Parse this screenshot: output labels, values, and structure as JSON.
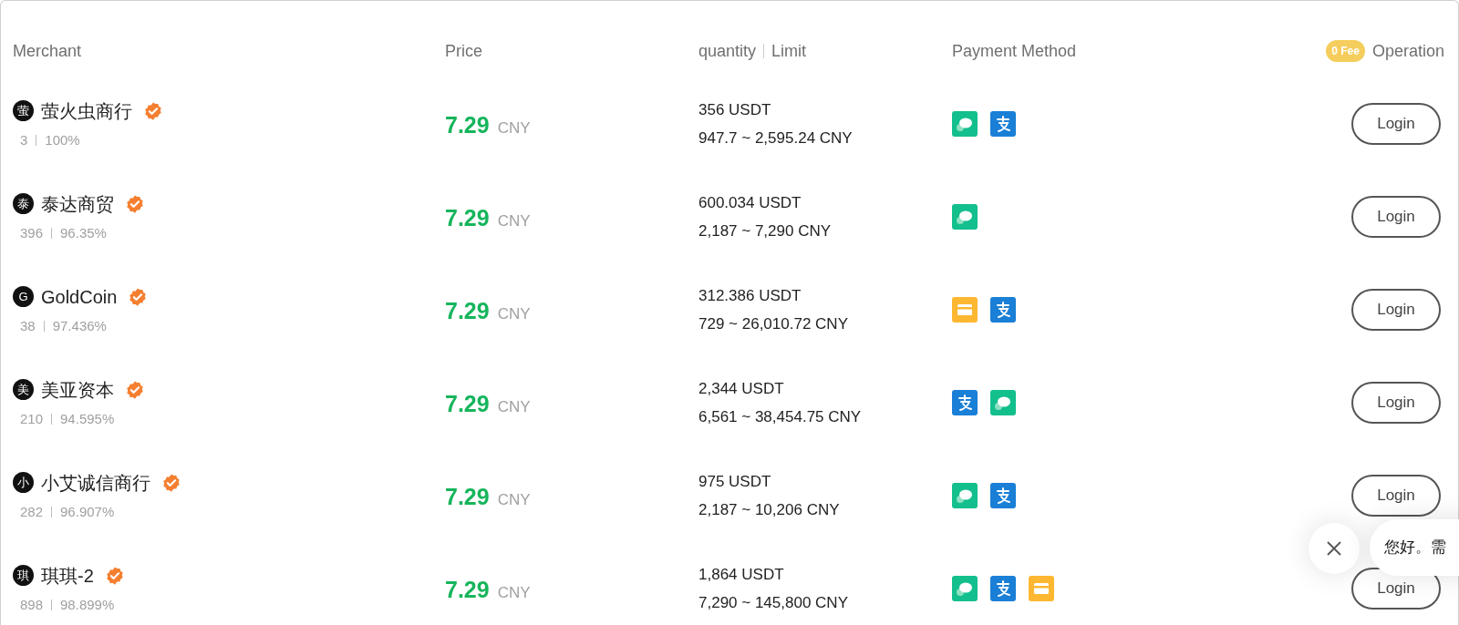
{
  "columns": {
    "merchant": "Merchant",
    "price": "Price",
    "quantity": "quantity",
    "limit": "Limit",
    "payment": "Payment Method",
    "fee_badge": "0 Fee",
    "operation": "Operation"
  },
  "rows": [
    {
      "avatar": "萤",
      "name": "萤火虫商行",
      "orders": "3",
      "completion": "100%",
      "price": "7.29",
      "currency": "CNY",
      "quantity": "356 USDT",
      "limit": "947.7 ~ 2,595.24 CNY",
      "payments": [
        {
          "kind": "wechat"
        },
        {
          "kind": "alipay"
        }
      ],
      "action": "Login"
    },
    {
      "avatar": "泰",
      "name": "泰达商贸",
      "orders": "396",
      "completion": "96.35%",
      "price": "7.29",
      "currency": "CNY",
      "quantity": "600.034 USDT",
      "limit": "2,187 ~ 7,290 CNY",
      "payments": [
        {
          "kind": "wechat"
        }
      ],
      "action": "Login"
    },
    {
      "avatar": "G",
      "name": "GoldCoin",
      "orders": "38",
      "completion": "97.436%",
      "price": "7.29",
      "currency": "CNY",
      "quantity": "312.386 USDT",
      "limit": "729 ~ 26,010.72 CNY",
      "payments": [
        {
          "kind": "bank"
        },
        {
          "kind": "alipay"
        }
      ],
      "action": "Login"
    },
    {
      "avatar": "美",
      "name": "美亚资本",
      "orders": "210",
      "completion": "94.595%",
      "price": "7.29",
      "currency": "CNY",
      "quantity": "2,344 USDT",
      "limit": "6,561 ~ 38,454.75 CNY",
      "payments": [
        {
          "kind": "alipay"
        },
        {
          "kind": "wechat"
        }
      ],
      "action": "Login"
    },
    {
      "avatar": "小",
      "name": "小艾诚信商行",
      "orders": "282",
      "completion": "96.907%",
      "price": "7.29",
      "currency": "CNY",
      "quantity": "975 USDT",
      "limit": "2,187 ~ 10,206 CNY",
      "payments": [
        {
          "kind": "wechat"
        },
        {
          "kind": "alipay"
        }
      ],
      "action": "Login"
    },
    {
      "avatar": "琪",
      "name": "琪琪-2",
      "orders": "898",
      "completion": "98.899%",
      "price": "7.29",
      "currency": "CNY",
      "quantity": "1,864 USDT",
      "limit": "7,290 ~ 145,800 CNY",
      "payments": [
        {
          "kind": "wechat"
        },
        {
          "kind": "alipay"
        },
        {
          "kind": "bank"
        }
      ],
      "action": "Login"
    }
  ],
  "chat": {
    "message": "您好。需"
  }
}
